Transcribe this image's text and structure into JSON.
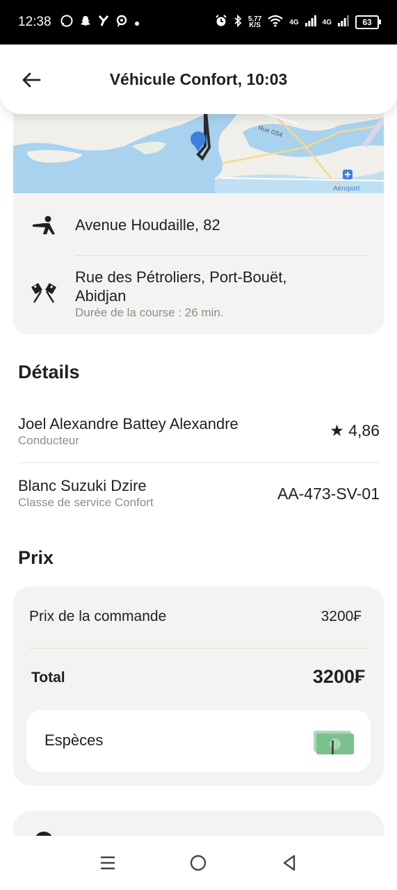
{
  "status_bar": {
    "time": "12:38",
    "speed_value": "5,77",
    "speed_unit": "K/S",
    "net1": "4G",
    "net2": "4G",
    "battery": "63"
  },
  "map": {
    "road_label": "Rue G54",
    "airport_label": "Aéroport"
  },
  "header": {
    "title": "Véhicule Confort, 10:03",
    "back_icon": "arrow-left-icon"
  },
  "route": {
    "pickup": {
      "icon": "person-waving-icon",
      "address": "Avenue Houdaille, 82"
    },
    "destination": {
      "icon": "checkered-flags-icon",
      "address_line1": "Rue des Pétroliers, Port-Bouët,",
      "address_line2": "Abidjan",
      "duration": "Durée de la course : 26 min."
    }
  },
  "details": {
    "title": "Détails",
    "driver": {
      "name": "Joel Alexandre Battey Alexandre",
      "role": "Conducteur",
      "rating": "4,86"
    },
    "vehicle": {
      "car": "Blanc Suzuki Dzire",
      "class": "Classe de service Confort",
      "plate": "AA-473-SV-01"
    }
  },
  "price": {
    "title": "Prix",
    "order_label": "Prix de la commande",
    "order_value": "3200₣",
    "total_label": "Total",
    "total_value": "3200₣",
    "payment_method": "Espèces",
    "payment_icon": "cash-banknote-icon"
  },
  "colors": {
    "card_bg": "#f4f3f1",
    "pin_blue": "#3f7fe0",
    "water": "#a9d2ee",
    "land": "#f1efe9",
    "cash_green": "#7cc08e"
  }
}
